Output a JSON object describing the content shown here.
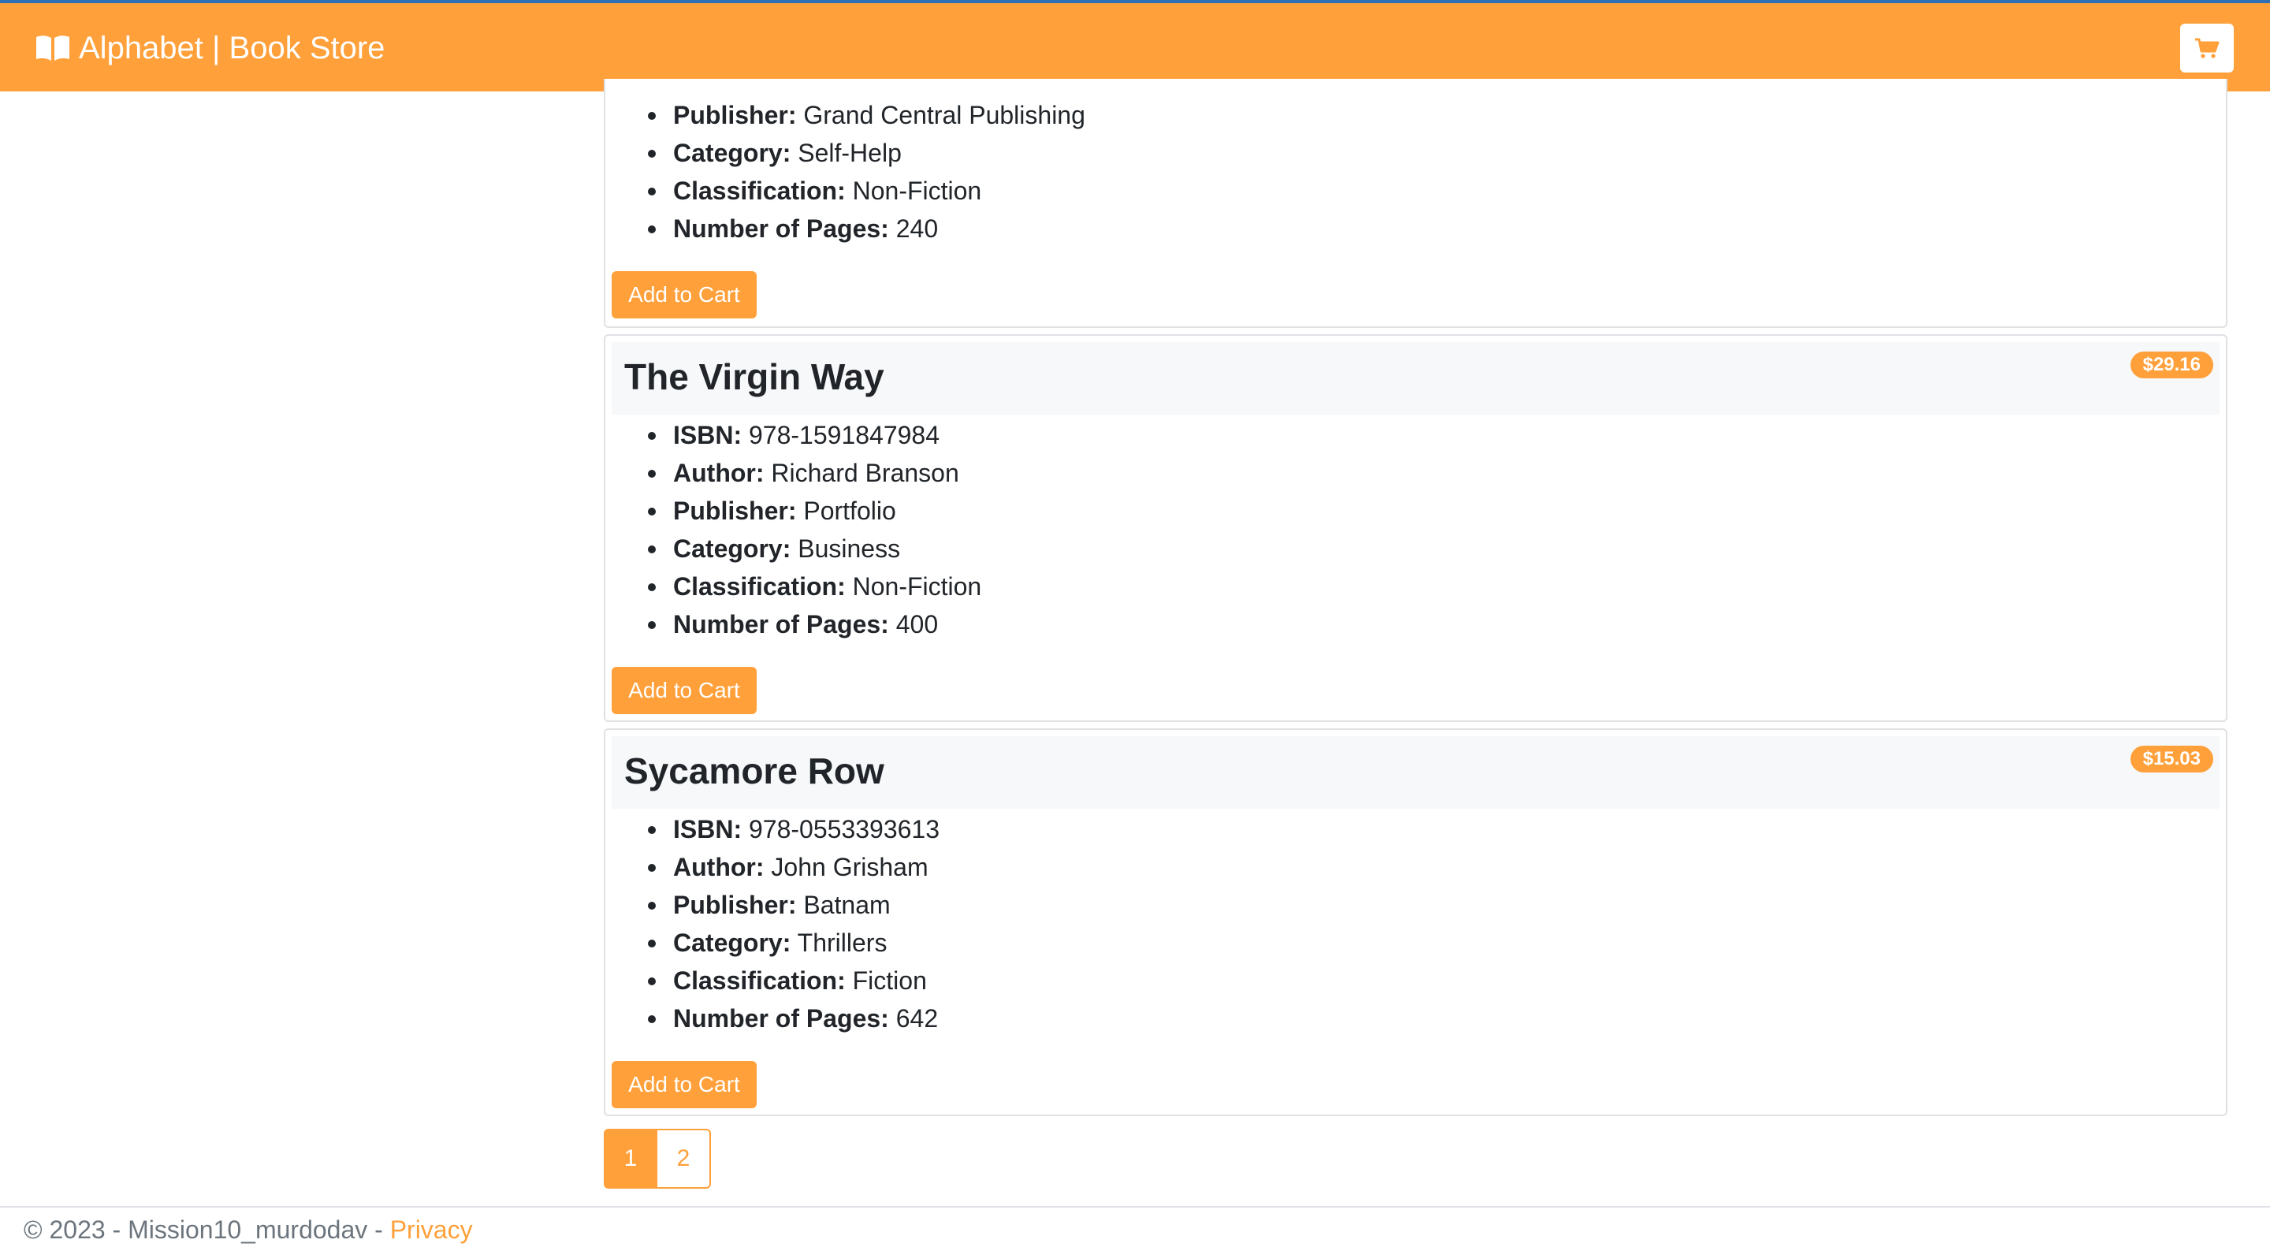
{
  "navbar": {
    "brand": "Alphabet | Book Store",
    "brand_icon": "open-book-icon",
    "cart_icon": "shopping-cart-icon",
    "color": "#ffa03a"
  },
  "books": [
    {
      "details": [
        {
          "label": "Publisher:",
          "value": "Grand Central Publishing"
        },
        {
          "label": "Category:",
          "value": "Self-Help"
        },
        {
          "label": "Classification:",
          "value": "Non-Fiction"
        },
        {
          "label": "Number of Pages:",
          "value": "240"
        }
      ],
      "button": "Add to Cart"
    },
    {
      "title": "The Virgin Way",
      "price": "$29.16",
      "details": [
        {
          "label": "ISBN:",
          "value": "978-1591847984"
        },
        {
          "label": "Author:",
          "value": "Richard Branson"
        },
        {
          "label": "Publisher:",
          "value": "Portfolio"
        },
        {
          "label": "Category:",
          "value": "Business"
        },
        {
          "label": "Classification:",
          "value": "Non-Fiction"
        },
        {
          "label": "Number of Pages:",
          "value": "400"
        }
      ],
      "button": "Add to Cart"
    },
    {
      "title": "Sycamore Row",
      "price": "$15.03",
      "details": [
        {
          "label": "ISBN:",
          "value": "978-0553393613"
        },
        {
          "label": "Author:",
          "value": "John Grisham"
        },
        {
          "label": "Publisher:",
          "value": "Batnam"
        },
        {
          "label": "Category:",
          "value": "Thrillers"
        },
        {
          "label": "Classification:",
          "value": "Fiction"
        },
        {
          "label": "Number of Pages:",
          "value": "642"
        }
      ],
      "button": "Add to Cart"
    }
  ],
  "pagination": {
    "pages": [
      "1",
      "2"
    ],
    "current": "1"
  },
  "footer": {
    "text": "© 2023 - Mission10_murdodav - ",
    "privacy_link": "Privacy"
  }
}
